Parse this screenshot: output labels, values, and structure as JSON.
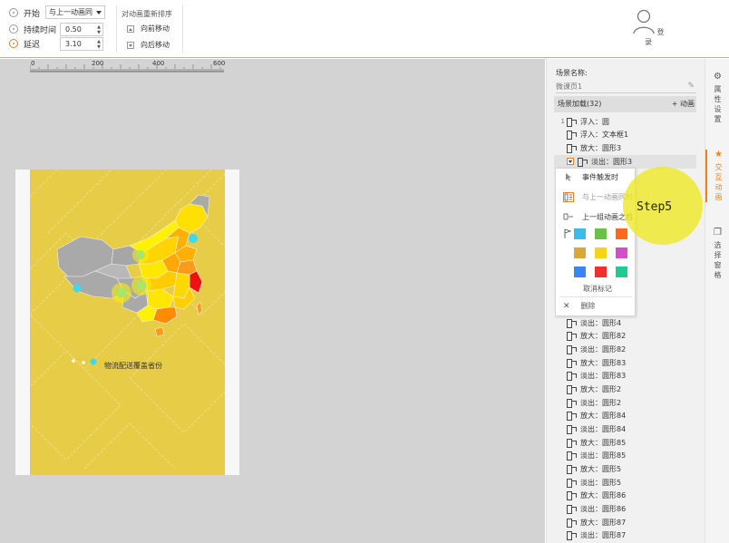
{
  "toolbar": {
    "start_label": "开始",
    "start_value": "与上一动画同",
    "duration_label": "持续时间",
    "duration_value": "0.50",
    "delay_label": "延迟",
    "delay_value": "3.10",
    "reorder_title": "对动画重新排序",
    "move_forward": "向前移动",
    "move_backward": "向后移动",
    "login_label": "登录"
  },
  "ruler": {
    "ticks": [
      "0",
      "200",
      "400",
      "600"
    ]
  },
  "slide": {
    "caption": "物流配送覆盖省份"
  },
  "panel": {
    "scene_title": "场景名称:",
    "scene_name": "微课页1",
    "scene_load": "场景加载(32)",
    "add_animation": "+ 动画",
    "animations": [
      {
        "num": "1",
        "label": "浮入：圆"
      },
      {
        "num": "",
        "label": "浮入：文本框1"
      },
      {
        "num": "",
        "label": "放大：圆形3"
      },
      {
        "num": "",
        "label": "淡出：圆形3",
        "selected": true
      },
      {
        "num": "",
        "label": "淡出：圆形4"
      },
      {
        "num": "",
        "label": "放大：圆形82"
      },
      {
        "num": "",
        "label": "淡出：圆形82"
      },
      {
        "num": "",
        "label": "放大：圆形83"
      },
      {
        "num": "",
        "label": "淡出：圆形83"
      },
      {
        "num": "",
        "label": "放大：圆形2"
      },
      {
        "num": "",
        "label": "淡出：圆形2"
      },
      {
        "num": "",
        "label": "放大：圆形84"
      },
      {
        "num": "",
        "label": "淡出：圆形84"
      },
      {
        "num": "",
        "label": "放大：圆形85"
      },
      {
        "num": "",
        "label": "淡出：圆形85"
      },
      {
        "num": "",
        "label": "放大：圆形5"
      },
      {
        "num": "",
        "label": "淡出：圆形5"
      },
      {
        "num": "",
        "label": "放大：圆形86"
      },
      {
        "num": "",
        "label": "淡出：圆形86"
      },
      {
        "num": "",
        "label": "放大：圆形87"
      },
      {
        "num": "",
        "label": "淡出：圆形87"
      }
    ]
  },
  "menu": {
    "on_event": "事件触发时",
    "with_previous": "与上一动画同时",
    "after_previous_group": "上一组动画之后",
    "swatches": [
      "#3bbce8",
      "#6cc04a",
      "#ff6a1a",
      "#d6a93a",
      "#f4d51c",
      "#d34fc6",
      "#3a85f5",
      "#f03030",
      "#1dcc8e"
    ],
    "cancel_mark": "取消标记",
    "delete": "删除"
  },
  "step_bubble": {
    "text": "Step5"
  },
  "side_tabs": {
    "properties": "属性设置",
    "interactive_animation": "交互动画",
    "select_window": "选择窗格"
  }
}
